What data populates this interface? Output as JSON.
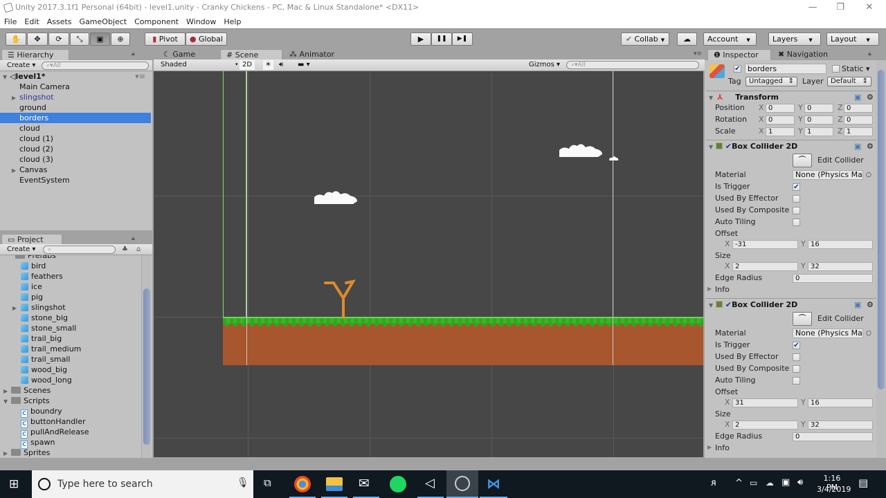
{
  "window": {
    "title": "Unity 2017.3.1f1 Personal (64bit) - level1.unity - Cranky Chickens - PC, Mac & Linux Standalone* <DX11>",
    "controls": {
      "minimize": "—",
      "restore": "❐",
      "close": "✕"
    }
  },
  "menu": [
    "File",
    "Edit",
    "Assets",
    "GameObject",
    "Component",
    "Window",
    "Help"
  ],
  "toolbar": {
    "tools": [
      "hand-tool",
      "move-tool",
      "rotate-tool",
      "scale-tool",
      "rect-tool",
      "transform-tool"
    ],
    "tool_glyphs": [
      "✋",
      "✥",
      "⟳",
      "⤡",
      "▣",
      "⊕"
    ],
    "active_tool": "rect-tool",
    "pivot_label": "Pivot",
    "global_label": "Global",
    "play": "▶",
    "pause": "❚❚",
    "step": "▶❚",
    "collab_label": "Collab",
    "cloud_glyph": "☁",
    "account_label": "Account",
    "layers_label": "Layers",
    "layout_label": "Layout"
  },
  "hierarchy": {
    "tab_label": "Hierarchy",
    "create_label": "Create",
    "search_placeholder": "All",
    "scene_name": "level1*",
    "items": [
      {
        "label": "Main Camera",
        "expandable": false,
        "selected": false,
        "prefab": false
      },
      {
        "label": "slingshot",
        "expandable": true,
        "selected": false,
        "prefab": true
      },
      {
        "label": "ground",
        "expandable": false,
        "selected": false,
        "prefab": false
      },
      {
        "label": "borders",
        "expandable": false,
        "selected": true,
        "prefab": false
      },
      {
        "label": "cloud",
        "expandable": false,
        "selected": false,
        "prefab": false
      },
      {
        "label": "cloud (1)",
        "expandable": false,
        "selected": false,
        "prefab": false
      },
      {
        "label": "cloud (2)",
        "expandable": false,
        "selected": false,
        "prefab": false
      },
      {
        "label": "cloud (3)",
        "expandable": false,
        "selected": false,
        "prefab": false
      },
      {
        "label": "Canvas",
        "expandable": true,
        "selected": false,
        "prefab": false
      },
      {
        "label": "EventSystem",
        "expandable": false,
        "selected": false,
        "prefab": false
      }
    ]
  },
  "project": {
    "tab_label": "Project",
    "create_label": "Create",
    "search_placeholder": "",
    "partial_folder": "Prefabs",
    "prefabs": [
      "bird",
      "feathers",
      "ice",
      "pig",
      "slingshot",
      "stone_big",
      "stone_small",
      "trail_big",
      "trail_medium",
      "trail_small",
      "wood_big",
      "wood_long"
    ],
    "folders": [
      {
        "label": "Scenes",
        "expanded": false
      },
      {
        "label": "Scripts",
        "expanded": true
      }
    ],
    "scripts": [
      "boundry",
      "buttonHandler",
      "pullAndRelease",
      "spawn"
    ],
    "last_folder": "Sprites"
  },
  "scene_view": {
    "tabs": [
      {
        "label": "Game",
        "icon": "☾",
        "active": false
      },
      {
        "label": "Scene",
        "icon": "#",
        "active": true
      },
      {
        "label": "Animator",
        "icon": "⁂",
        "active": false
      }
    ],
    "shading_mode": "Shaded",
    "mode_2d": "2D",
    "gizmos_label": "Gizmos",
    "search_placeholder": "All"
  },
  "inspector": {
    "tabs": [
      {
        "label": "Inspector",
        "active": true
      },
      {
        "label": "Navigation",
        "active": false
      }
    ],
    "object_name": "borders",
    "active": true,
    "static_label": "Static",
    "tag_label": "Tag",
    "tag_value": "Untagged",
    "layer_label": "Layer",
    "layer_value": "Default",
    "transform": {
      "title": "Transform",
      "rows": [
        {
          "label": "Position",
          "x": "0",
          "y": "0",
          "z": "0"
        },
        {
          "label": "Rotation",
          "x": "0",
          "y": "0",
          "z": "0"
        },
        {
          "label": "Scale",
          "x": "1",
          "y": "1",
          "z": "1"
        }
      ]
    },
    "colliders": [
      {
        "title": "Box Collider 2D",
        "edit_label": "Edit Collider",
        "material_label": "Material",
        "material_value": "None (Physics Mat",
        "is_trigger_label": "Is Trigger",
        "is_trigger": true,
        "used_by_effector_label": "Used By Effector",
        "used_by_effector": false,
        "used_by_composite_label": "Used By Composite",
        "used_by_composite": false,
        "auto_tiling_label": "Auto Tiling",
        "auto_tiling": false,
        "offset_label": "Offset",
        "offset_x": "-31",
        "offset_y": "16",
        "size_label": "Size",
        "size_x": "2",
        "size_y": "32",
        "edge_radius_label": "Edge Radius",
        "edge_radius": "0",
        "info_label": "Info"
      },
      {
        "title": "Box Collider 2D",
        "edit_label": "Edit Collider",
        "material_label": "Material",
        "material_value": "None (Physics Mat",
        "is_trigger_label": "Is Trigger",
        "is_trigger": true,
        "used_by_effector_label": "Used By Effector",
        "used_by_effector": false,
        "used_by_composite_label": "Used By Composite",
        "used_by_composite": false,
        "auto_tiling_label": "Auto Tiling",
        "auto_tiling": false,
        "offset_label": "Offset",
        "offset_x": "31",
        "offset_y": "16",
        "size_label": "Size",
        "size_x": "2",
        "size_y": "32",
        "edge_radius_label": "Edge Radius",
        "edge_radius": "0",
        "info_label": "Info"
      }
    ]
  },
  "taskbar": {
    "search_placeholder": "Type here to search",
    "apps": [
      "task-view",
      "chrome",
      "file-explorer",
      "mail",
      "spotify",
      "unity",
      "obs",
      "visual-studio-code"
    ],
    "time": "1:16 PM",
    "date": "3/4/2019"
  },
  "colors": {
    "selection": "#3d80df",
    "scene_bg": "#474747",
    "grass": "#2fa81e",
    "dirt": "#a8562e",
    "slingshot": "#e08a2c",
    "collider_outline": "#8cd67a"
  }
}
